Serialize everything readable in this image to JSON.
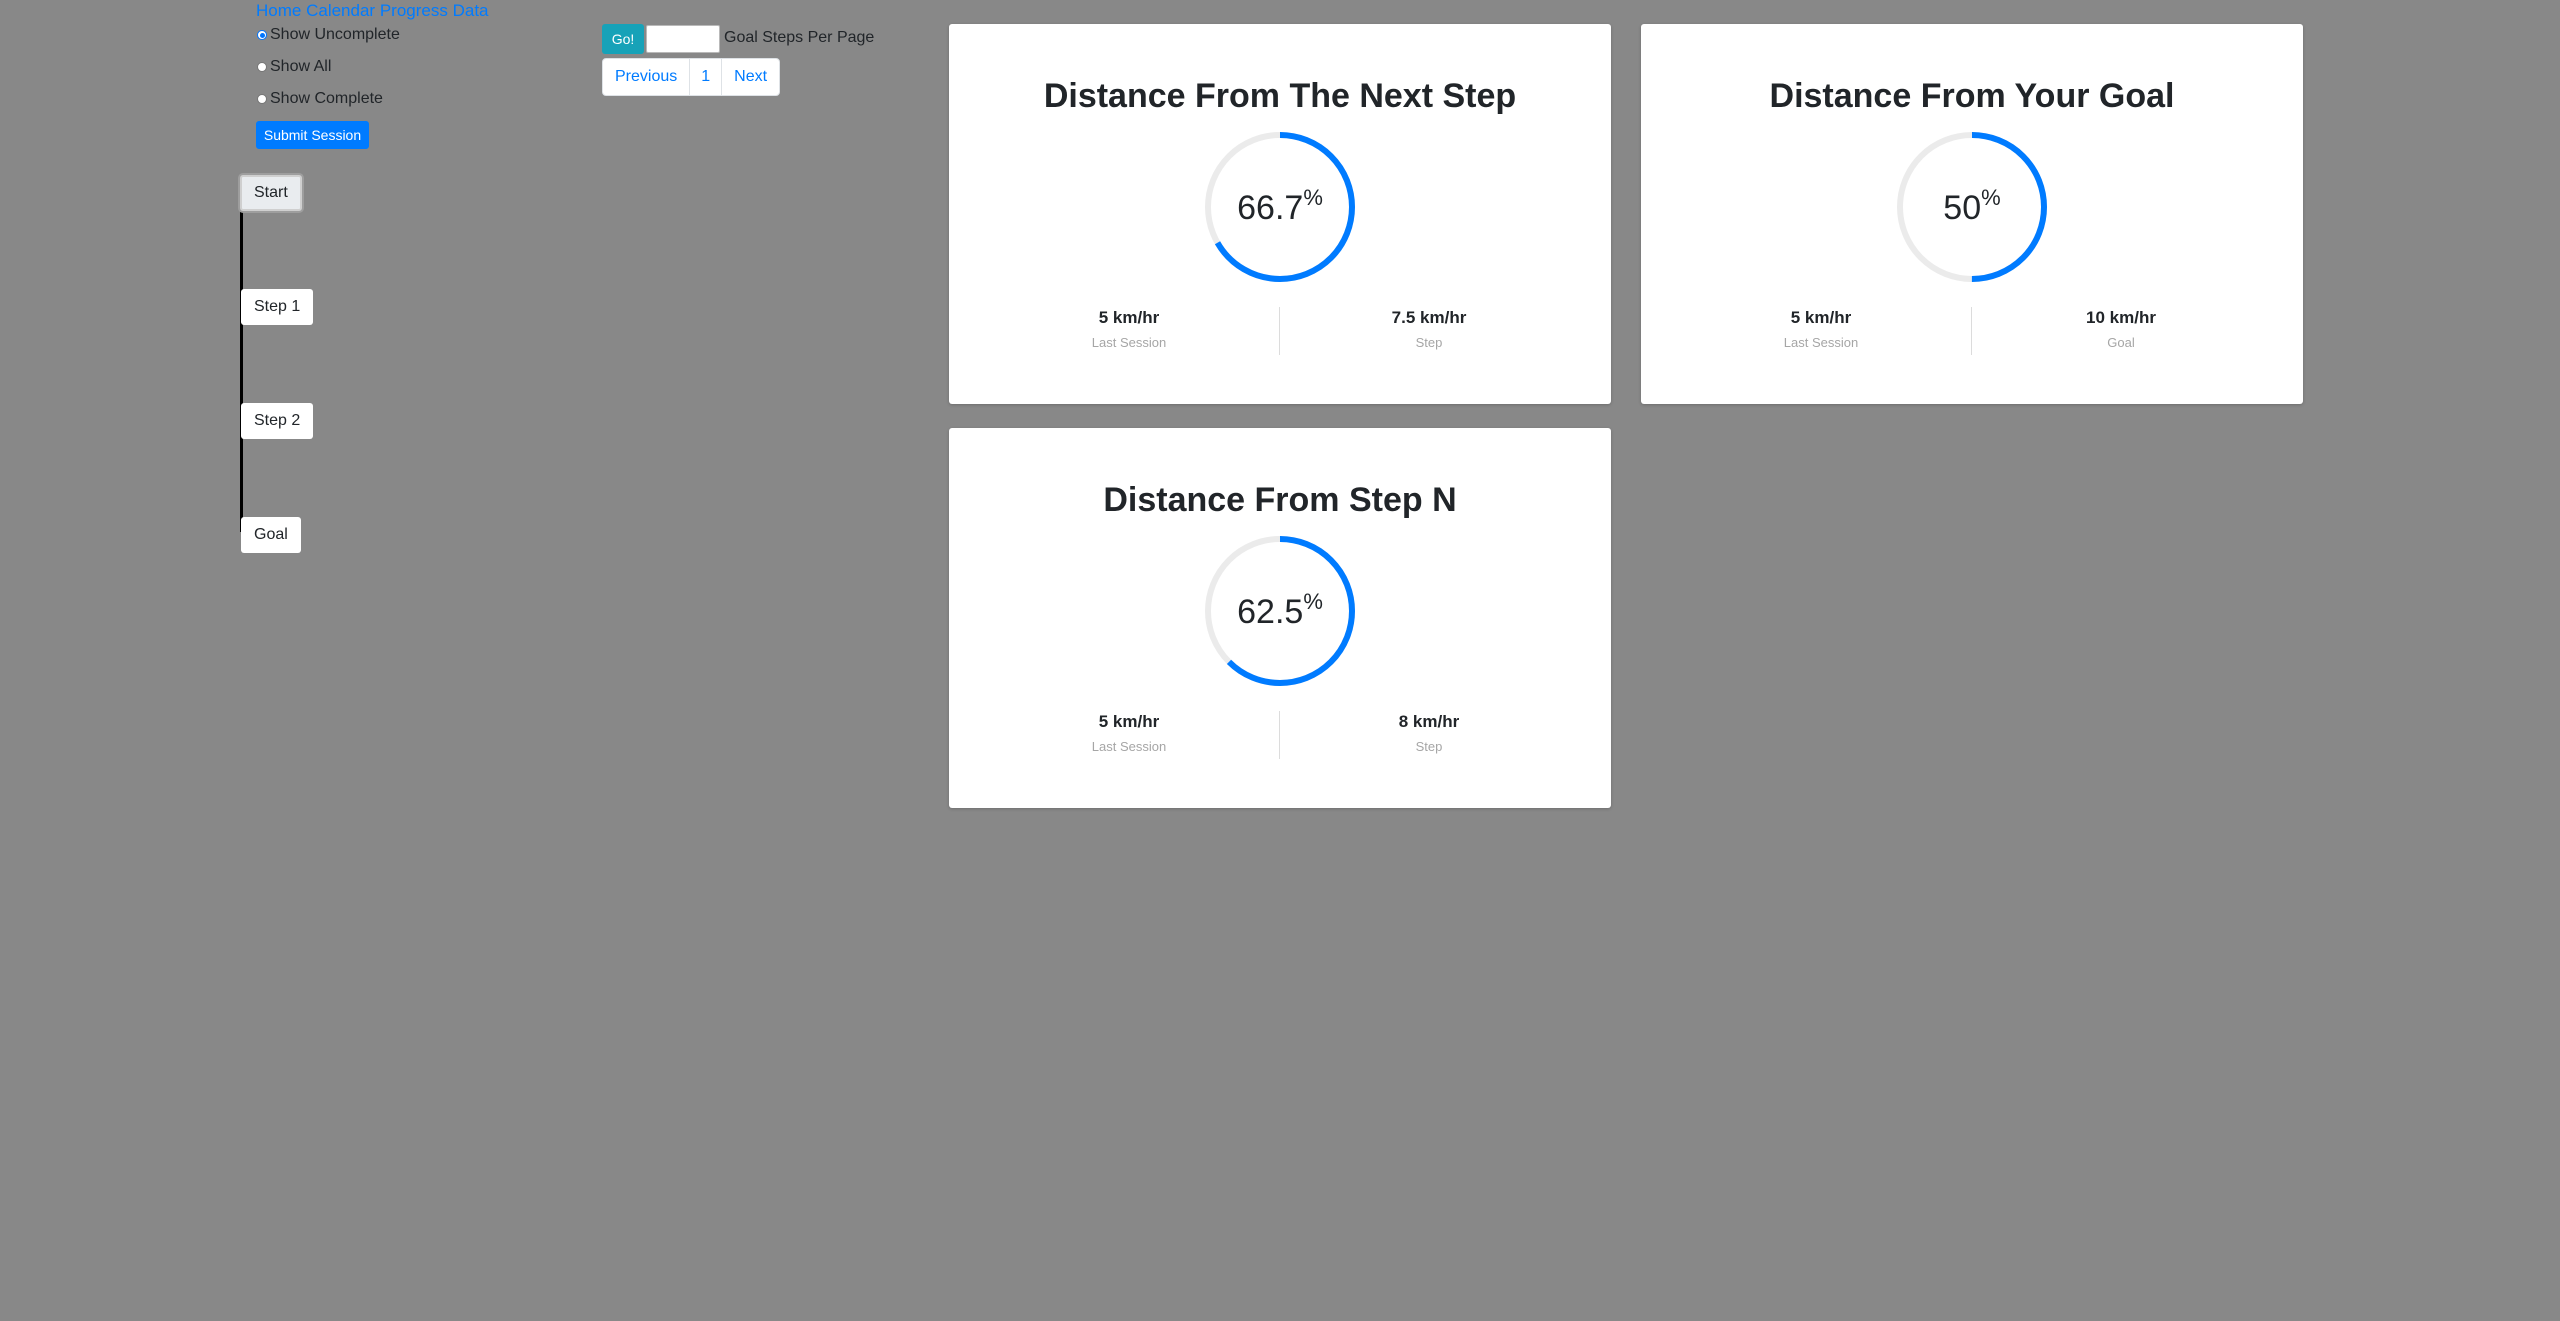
{
  "nav": {
    "links": [
      "Home",
      "Calendar",
      "Progress",
      "Data"
    ]
  },
  "filters": {
    "options": [
      {
        "label": "Show Uncomplete",
        "checked": true
      },
      {
        "label": "Show All",
        "checked": false
      },
      {
        "label": "Show Complete",
        "checked": false
      }
    ],
    "submit_label": "Submit Session"
  },
  "timeline": {
    "steps": [
      "Start",
      "Step 1",
      "Step 2",
      "Goal"
    ]
  },
  "toolbar": {
    "go_label": "Go!",
    "steps_per_page_value": "",
    "steps_per_page_label": "Goal Steps Per Page"
  },
  "pagination": {
    "previous": "Previous",
    "page": "1",
    "next": "Next"
  },
  "colors": {
    "accent": "#007bff",
    "go_button": "#17a2b8",
    "background": "#888888",
    "gauge_track": "#ebebeb"
  },
  "cards": [
    {
      "title": "Distance From The Next Step",
      "percent": 66.7,
      "percent_text": "66.7",
      "unit": "%",
      "left_value": "5 km/hr",
      "left_label": "Last Session",
      "right_value": "7.5 km/hr",
      "right_label": "Step"
    },
    {
      "title": "Distance From Your Goal",
      "percent": 50,
      "percent_text": "50",
      "unit": "%",
      "left_value": "5 km/hr",
      "left_label": "Last Session",
      "right_value": "10 km/hr",
      "right_label": "Goal"
    },
    {
      "title": "Distance From Step N",
      "percent": 62.5,
      "percent_text": "62.5",
      "unit": "%",
      "left_value": "5 km/hr",
      "left_label": "Last Session",
      "right_value": "8 km/hr",
      "right_label": "Step"
    }
  ]
}
